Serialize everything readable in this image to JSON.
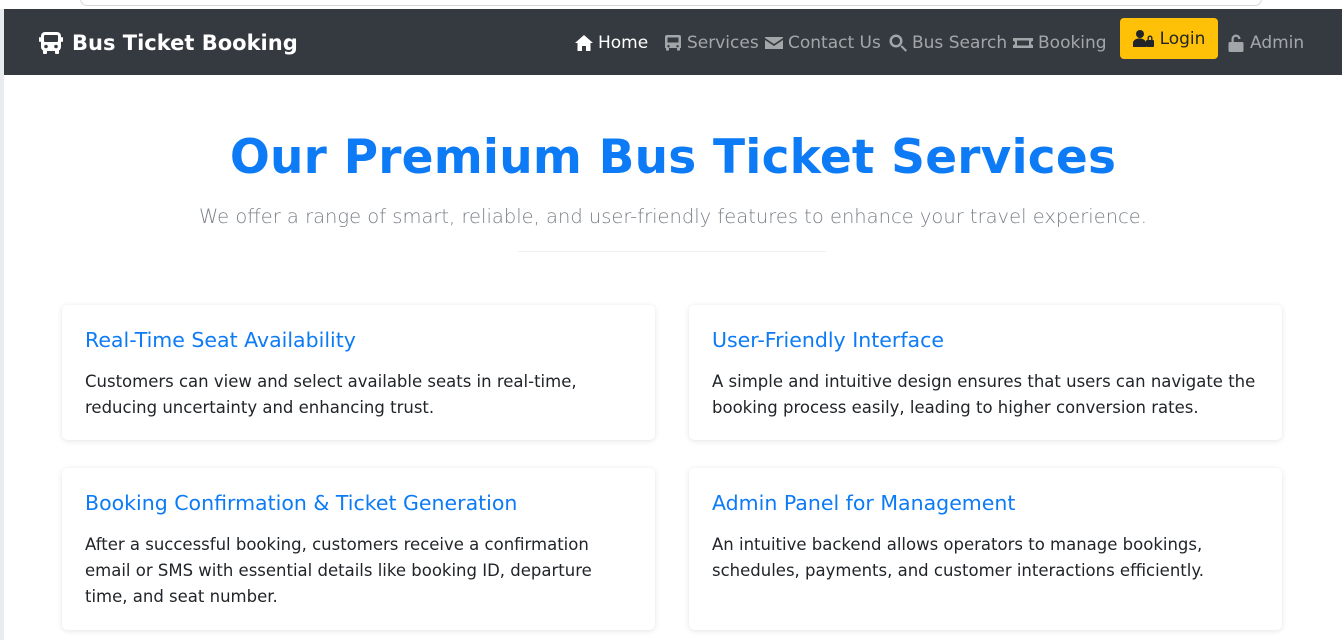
{
  "brand": {
    "title": "Bus Ticket Booking",
    "icon": "bus-icon"
  },
  "nav": {
    "items": [
      {
        "label": "Home",
        "icon": "home-icon",
        "active": true
      },
      {
        "label": "Services",
        "icon": "bus-icon"
      },
      {
        "label": "Contact Us",
        "icon": "envelope-icon"
      },
      {
        "label": "Bus Search",
        "icon": "search-icon"
      },
      {
        "label": "Booking",
        "icon": "ticket-icon"
      }
    ],
    "login_label": "Login",
    "admin_label": "Admin"
  },
  "hero": {
    "title": "Our Premium Bus Ticket Services",
    "subtitle": "We offer a range of smart, reliable, and user-friendly features to enhance your travel experience."
  },
  "services": [
    {
      "title": "Real-Time Seat Availability",
      "text": "Customers can view and select available seats in real-time, reducing uncertainty and enhancing trust."
    },
    {
      "title": "User-Friendly Interface",
      "text": "A simple and intuitive design ensures that users can navigate the booking process easily, leading to higher conversion rates."
    },
    {
      "title": "Booking Confirmation & Ticket Generation",
      "text": "After a successful booking, customers receive a confirmation email or SMS with essential details like booking ID, departure time, and seat number."
    },
    {
      "title": "Admin Panel for Management",
      "text": "An intuitive backend allows operators to manage bookings, schedules, payments, and customer interactions efficiently."
    }
  ],
  "colors": {
    "navbar": "#343a40",
    "accent": "#0d7bf6",
    "login_button": "#ffc107"
  }
}
